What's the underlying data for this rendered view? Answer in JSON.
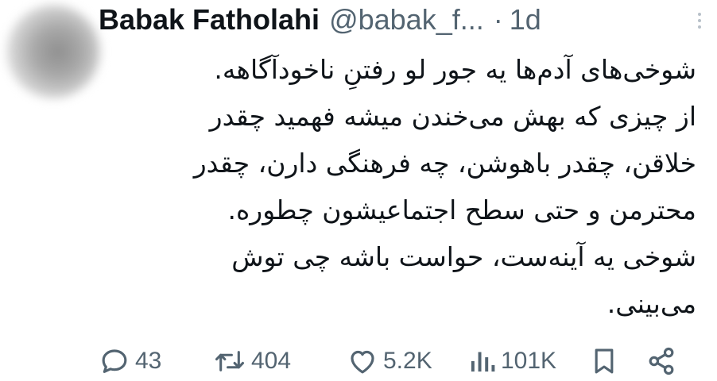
{
  "author": {
    "name": "Babak Fatholahi",
    "handle": "@babak_f...",
    "separator": "·",
    "time": "1d"
  },
  "tweet": {
    "lines": [
      "شوخی‌های آدم‌ها یه جور لو رفتنِ ناخودآگاهه.",
      "از چیزی که بهش می‌خندن میشه فهمید چقدر",
      "خلاقن، چقدر باهوشن، چه فرهنگی دارن، چقدر",
      "محترمن و حتی سطح اجتماعیشون چطوره.",
      "شوخی یه آینه‌ست، حواست باشه چی توش",
      "می‌بینی."
    ]
  },
  "actions": {
    "replies": "43",
    "retweets": "404",
    "likes": "5.2K",
    "views": "101K"
  },
  "icons": {
    "reply": "speech-bubble-icon",
    "retweet": "retweet-arrows-icon",
    "like": "heart-icon",
    "views": "bar-chart-icon",
    "bookmark": "bookmark-icon",
    "share": "share-icon",
    "more": "vertical-ellipsis-icon"
  },
  "colors": {
    "text": "#0f1419",
    "secondary": "#536471",
    "more_dots": "#b8c1c9"
  }
}
